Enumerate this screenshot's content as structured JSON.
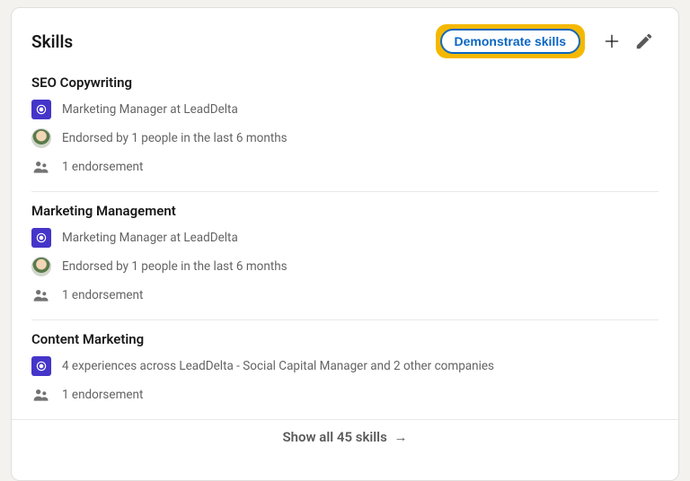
{
  "header": {
    "title": "Skills",
    "demonstrate_label": "Demonstrate skills"
  },
  "skills": [
    {
      "name": "SEO Copywriting",
      "details": [
        {
          "icon": "company",
          "text": "Marketing Manager at LeadDelta"
        },
        {
          "icon": "avatar",
          "text": "Endorsed by 1 people in the last 6 months"
        },
        {
          "icon": "people",
          "text": "1 endorsement"
        }
      ]
    },
    {
      "name": "Marketing Management",
      "details": [
        {
          "icon": "company",
          "text": "Marketing Manager at LeadDelta"
        },
        {
          "icon": "avatar",
          "text": "Endorsed by 1 people in the last 6 months"
        },
        {
          "icon": "people",
          "text": "1 endorsement"
        }
      ]
    },
    {
      "name": "Content Marketing",
      "details": [
        {
          "icon": "company",
          "text": "4 experiences across LeadDelta - Social Capital Manager and 2 other companies"
        },
        {
          "icon": "people",
          "text": "1 endorsement"
        }
      ]
    }
  ],
  "footer": {
    "show_all_label": "Show all 45 skills"
  }
}
